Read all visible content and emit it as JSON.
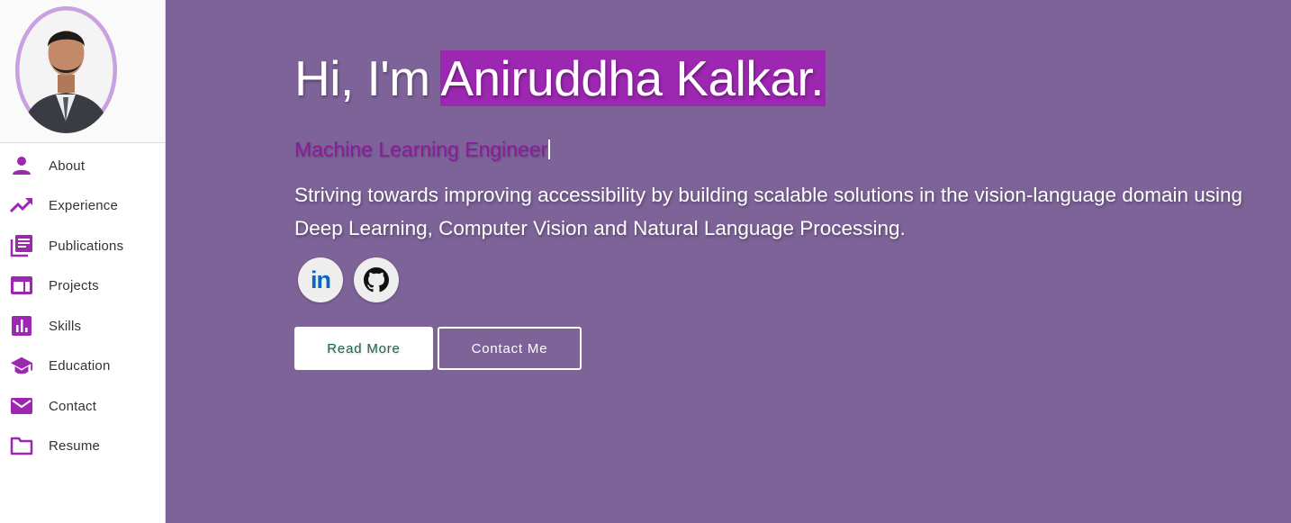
{
  "sidebar": {
    "profile_photo": "portrait-photo",
    "items": [
      {
        "label": "About",
        "icon": "person-icon"
      },
      {
        "label": "Experience",
        "icon": "trending-up-icon"
      },
      {
        "label": "Publications",
        "icon": "library-books-icon"
      },
      {
        "label": "Projects",
        "icon": "web-icon"
      },
      {
        "label": "Skills",
        "icon": "bar-chart-icon"
      },
      {
        "label": "Education",
        "icon": "school-icon"
      },
      {
        "label": "Contact",
        "icon": "mail-icon"
      },
      {
        "label": "Resume",
        "icon": "folder-icon"
      }
    ]
  },
  "hero": {
    "greeting": "Hi, I'm ",
    "name": "Aniruddha Kalkar.",
    "role": "Machine Learning Engineer",
    "description": "Striving towards improving accessibility by building scalable solutions in the vision-language domain using Deep Learning, Computer Vision and Natural Language Processing.",
    "social": [
      {
        "name": "linkedin-icon",
        "text": "in"
      },
      {
        "name": "github-icon"
      }
    ],
    "buttons": {
      "read_more": "Read More",
      "contact_me": "Contact Me"
    }
  },
  "colors": {
    "accent": "#9c27b0",
    "main_background": "#7e6399",
    "role_text": "#8b1a9c",
    "read_more_text": "#1f6b4a"
  }
}
